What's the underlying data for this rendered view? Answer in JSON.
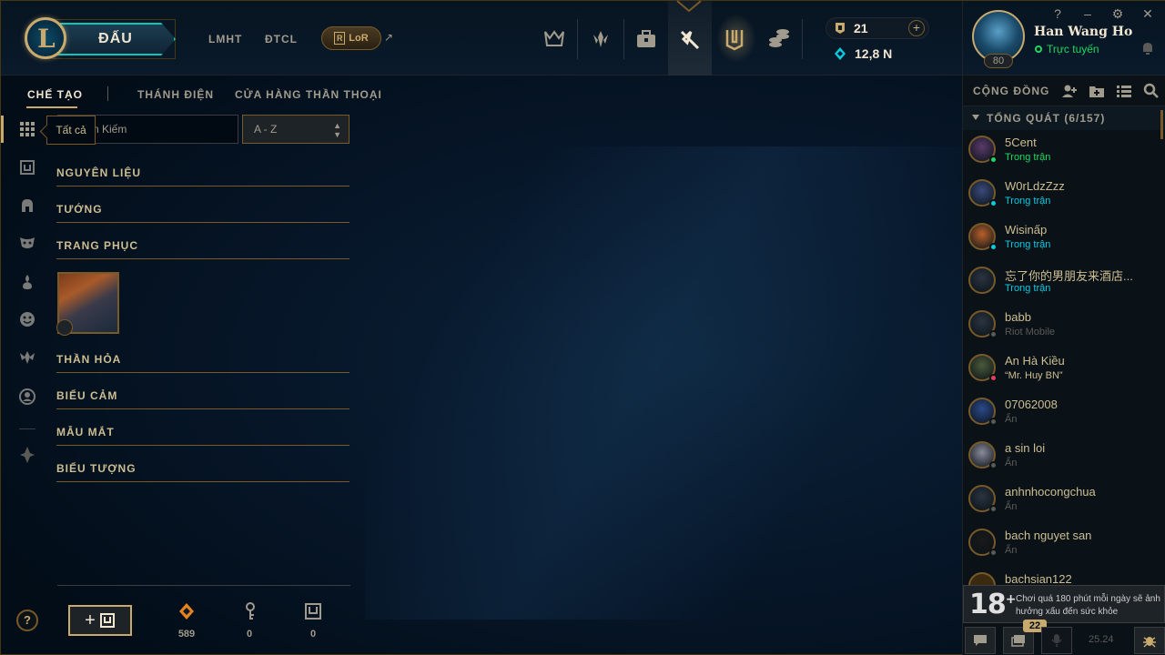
{
  "topbar": {
    "play_label": "ĐẤU",
    "nav": [
      "LMHT",
      "ĐTCL"
    ],
    "lor_label": "LoR",
    "lor_ext_icon": "external-link-icon",
    "blue_essence": "21",
    "orange_essence": "12,8 N",
    "icons": [
      "clash-icon",
      "rewards-icon",
      "collection-icon",
      "loot-icon",
      "tft-icon",
      "store-icon"
    ]
  },
  "profile": {
    "name": "Han Wang Ho",
    "status": "Trực tuyến",
    "level": "80",
    "window_controls": [
      "?",
      "–",
      "⚙",
      "✕"
    ]
  },
  "subnav": {
    "tabs": [
      "CHẾ TẠO",
      "THÁNH ĐIỆN",
      "CỬA HÀNG THẦN THOẠI"
    ]
  },
  "loot": {
    "tooltip": "Tất cả",
    "search_placeholder": "Tìm Kiếm",
    "search_visible": "n Kiếm",
    "sort_value": "A - Z",
    "categories": [
      "NGUYÊN LIỆU",
      "TƯỚNG",
      "TRANG PHỤC",
      "THẦN HỎA",
      "BIỂU CẢM",
      "MẪU MẮT",
      "BIỂU TƯỢNG"
    ],
    "help": "?",
    "resources": [
      {
        "icon": "orange-essence-icon",
        "value": "589"
      },
      {
        "icon": "key-fragment-icon",
        "value": "0"
      },
      {
        "icon": "chest-icon",
        "value": "0"
      }
    ]
  },
  "social": {
    "title": "CỘNG ĐỒNG",
    "group": "TỔNG QUÁT (6/157)",
    "friends": [
      {
        "name": "5Cent",
        "status": "Trong trận",
        "status_color": "#1ed760",
        "dot": "#1ed760",
        "avatar": "#5a3a6a"
      },
      {
        "name": "W0rLdzZzz",
        "status": "Trong trận",
        "status_color": "#0ac8e0",
        "dot": "#0ac8e0",
        "avatar": "#3a4a7a"
      },
      {
        "name": "Wisinấp",
        "status": "Trong trận",
        "status_color": "#0ac8e0",
        "dot": "#0ac8e0",
        "avatar": "#b8602a"
      },
      {
        "name": "忘了你的男朋友来酒店...",
        "status": "Trong trận",
        "status_color": "#0ac8e0",
        "dot": null,
        "avatar": "#2a3440"
      },
      {
        "name": "babb",
        "status": "Riot Mobile",
        "status_color": "#5b5a56",
        "dot": "#5b5a56",
        "avatar": "#2a3440"
      },
      {
        "name": "An Hà Kiều",
        "status": "“Mr. Huy BN”",
        "status_color": "#cdbe91",
        "dot": "#e84057",
        "avatar": "#4a5a3a"
      },
      {
        "name": "07062008",
        "status": "Ẩn",
        "status_color": "#5b5a56",
        "dot": "#5b5a56",
        "avatar": "#2a4a8a"
      },
      {
        "name": "a sin loi",
        "status": "Ẩn",
        "status_color": "#5b5a56",
        "dot": "#5b5a56",
        "avatar": "#8a8a9a"
      },
      {
        "name": "anhnhocongchua",
        "status": "Ẩn",
        "status_color": "#5b5a56",
        "dot": "#5b5a56",
        "avatar": "#2a3440"
      },
      {
        "name": "bach nguyet san",
        "status": "Ẩn",
        "status_color": "#5b5a56",
        "dot": "#5b5a56",
        "avatar": "#1a1a1a"
      }
    ],
    "partial_next": "bachsian122"
  },
  "warning": {
    "age": "18",
    "text": "Chơi quá 180 phút mỗi ngày sẽ ảnh hưởng xấu đến sức khỏe"
  },
  "socialbar": {
    "badge": "22",
    "version": "25.24"
  }
}
